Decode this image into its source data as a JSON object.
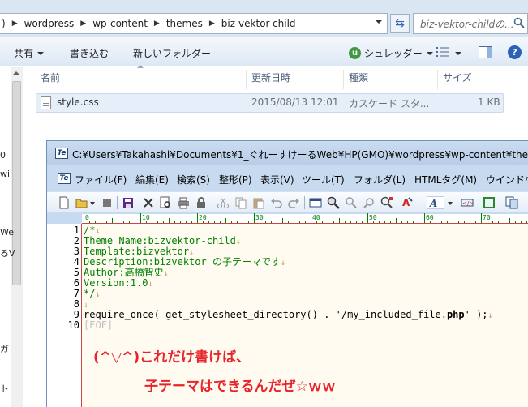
{
  "explorer": {
    "breadcrumbs": [
      ")",
      "wordpress",
      "wp-content",
      "themes",
      "biz-vektor-child"
    ],
    "search_placeholder": "biz-vektor-childの...",
    "commands": {
      "share": "共有",
      "burn": "書き込む",
      "new_folder": "新しいフォルダー",
      "shredder": "シュレッダー"
    },
    "columns": [
      "名前",
      "更新日時",
      "種類",
      "サイズ"
    ],
    "files": [
      {
        "name": "style.css",
        "modified": "2015/08/13 12:01",
        "type": "カスケード スタ...",
        "size": "1 KB"
      }
    ],
    "nav_fragments": [
      "0",
      "wi",
      "We",
      "るV",
      "ガ",
      "ト"
    ]
  },
  "editor": {
    "title": "C:¥Users¥Takahashi¥Documents¥1_ぐれーすけーるWeb¥HP(GMO)¥wordpress¥wp-content¥theme",
    "menu": [
      "ファイル(F)",
      "編集(E)",
      "検索(S)",
      "整形(P)",
      "表示(V)",
      "ツール(T)",
      "フォルダ(L)",
      "HTMLタグ(M)",
      "ウインドウ"
    ],
    "ruler_numbers": [
      "0",
      "10",
      "20",
      "30",
      "40",
      "50",
      "60",
      "70"
    ],
    "line_numbers": [
      "1",
      "2",
      "3",
      "4",
      "5",
      "6",
      "7",
      "8",
      "9",
      "10"
    ],
    "lines": [
      "/*",
      "Theme Name:bizvektor-child",
      "Template:bizvektor",
      "Description:bizvektor の子テーマです",
      "Author:高橋智史",
      "Version:1.0",
      "*/",
      "",
      "",
      "[EOF]"
    ],
    "require_line": {
      "prefix": "require_once( get_stylesheet_directory() . '/my_included_file.",
      "ext": "php",
      "suffix": "' );"
    },
    "line_feed_mark": "↓",
    "colors": {
      "comment": "#008000",
      "annotation": "#e8232a",
      "ruler_line": "#cc4444"
    }
  },
  "annotations": [
    "(^▽^)これだけ書けば、",
    "子テーマはできるんだぜ☆ｗｗ"
  ]
}
